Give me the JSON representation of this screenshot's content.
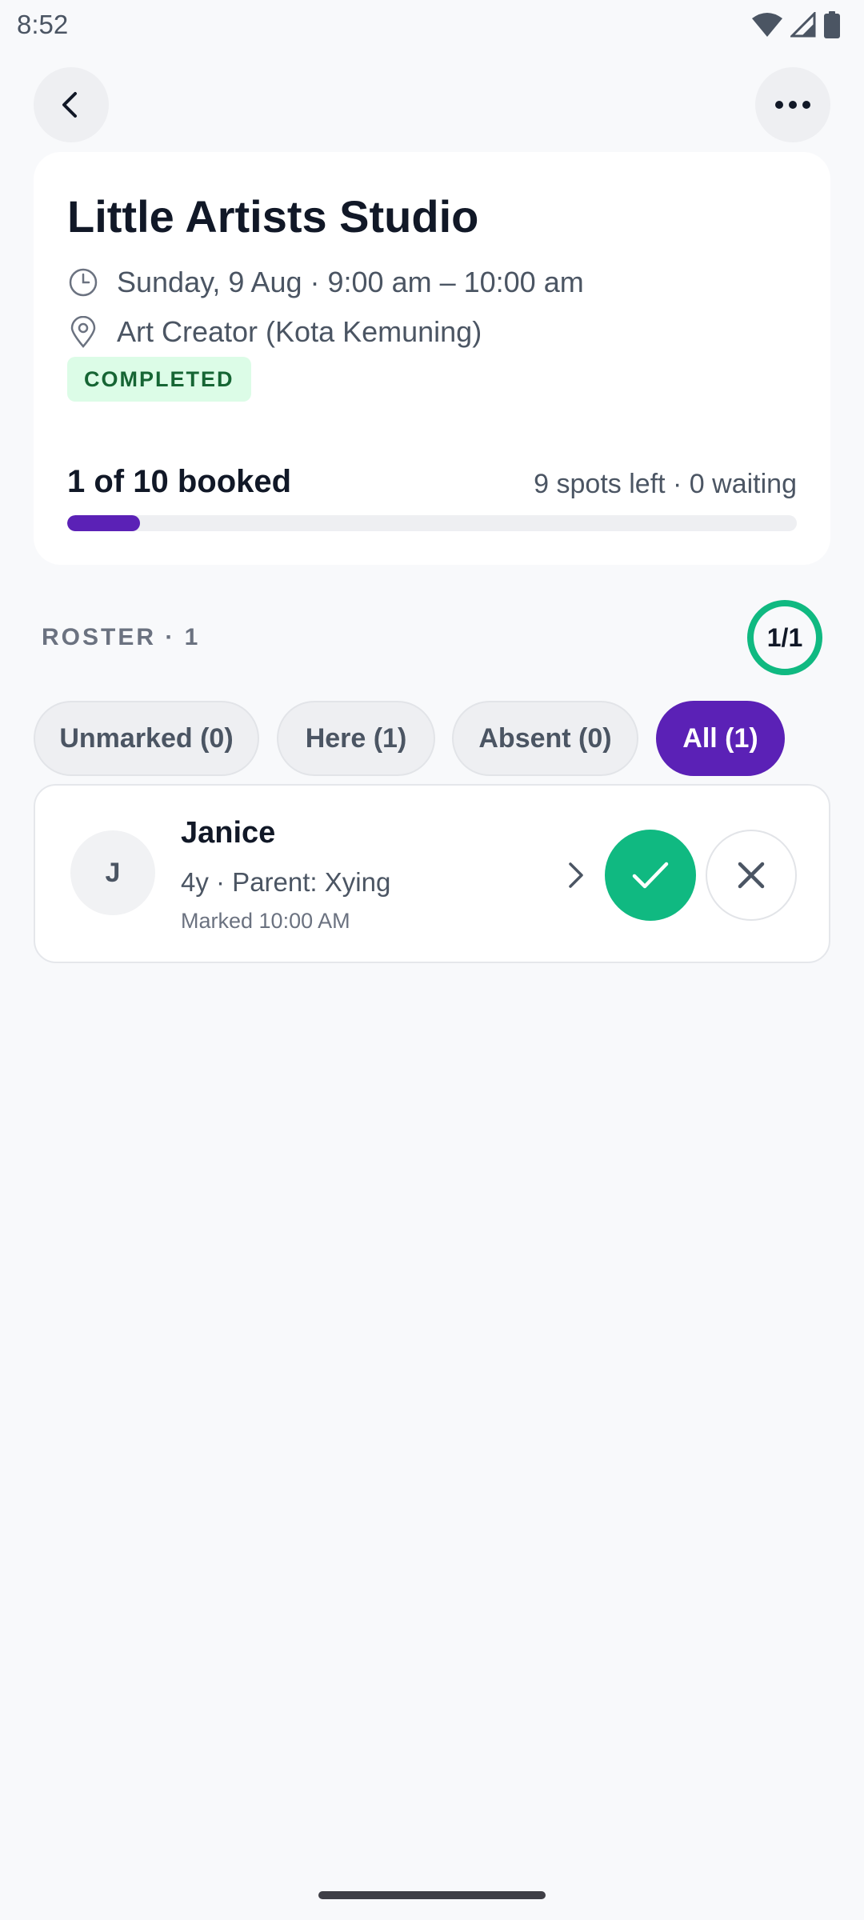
{
  "status_bar": {
    "time": "8:52"
  },
  "header": {
    "back_icon": "chevron-left-icon",
    "more_icon": "more-horizontal-icon"
  },
  "summary": {
    "title": "Little Artists Studio",
    "time_icon": "clock-icon",
    "datetime": "Sunday, 9 Aug · 9:00 am – 10:00 am",
    "location_icon": "map-pin-icon",
    "location": "Art Creator (Kota Kemuning)",
    "status": "COMPLETED",
    "booked_text": "1 of 10 booked",
    "spots_text": "9 spots left · 0 waiting",
    "booked_fraction": 0.1
  },
  "roster": {
    "label": "ROSTER · 1",
    "ratio": "1/1"
  },
  "filters": [
    {
      "label": "Unmarked (0)",
      "selected": false
    },
    {
      "label": "Here (1)",
      "selected": false
    },
    {
      "label": "Absent (0)",
      "selected": false
    },
    {
      "label": "All (1)",
      "selected": true
    }
  ],
  "attendees": [
    {
      "initial": "J",
      "name": "Janice",
      "meta": "4y · Parent: Xying",
      "marked": "Marked 10:00 AM",
      "status": "present"
    }
  ],
  "colors": {
    "accent": "#5b21b6",
    "success": "#10b981",
    "badge_bg": "#dcfce7",
    "badge_text": "#166534"
  }
}
